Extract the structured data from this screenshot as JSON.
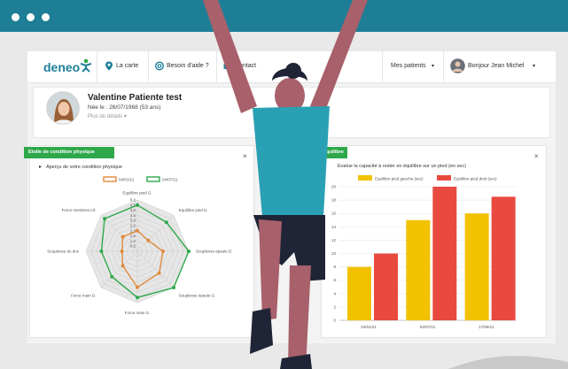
{
  "app": {
    "logo": "deneo",
    "nav": {
      "map": "La carte",
      "help": "Besoin d'aide ?",
      "contact": "Contact",
      "patients": "Mes patients",
      "user": "Bonjour Jean Michel"
    }
  },
  "patient": {
    "name": "Valentine Patiente test",
    "dob": "Née le : 26/07/1968 (53 ans)",
    "more": "Plus de détails"
  },
  "radar_panel": {
    "tag": "Etoile de condition physique",
    "subtitle": "Aperçu de votre condition physique",
    "close": "×"
  },
  "bar_panel": {
    "tag": "équilibre",
    "subtitle": "Evalue la capacité à rester en équilibre sur un pied (en sec)",
    "close": "×"
  },
  "colors": {
    "brand": "#1f7f99",
    "green": "#2ea84a",
    "orange": "#e08a3c",
    "yellow": "#f2c200",
    "red": "#e84a3f",
    "figure_skin": "#a8606a",
    "figure_shirt": "#2aa0b4",
    "figure_pants": "#1f2536"
  },
  "chart_data": [
    {
      "type": "radar",
      "series": [
        {
          "name": "04/01/21",
          "color": "#e08a3c",
          "values": [
            2,
            1.5,
            2.5,
            3,
            3.5,
            2,
            1.5,
            2
          ]
        },
        {
          "name": "04/07/21",
          "color": "#2ea84a",
          "values": [
            4.5,
            4,
            5,
            5,
            4.5,
            3.5,
            3.5,
            4.5
          ]
        }
      ],
      "axes": [
        "Equilibre pied G.",
        "Equilibre pied D.",
        "Souplesse épaule D.",
        "Souplesse épaule G.",
        "Force main G.",
        "Force main D.",
        "Souplesse du dos",
        "Force membres inf."
      ],
      "ticks": [
        "5.0",
        "4.5",
        "4.0",
        "3.5",
        "3.0",
        "2.5",
        "2.0",
        "1.5",
        "1.0",
        "0.5"
      ],
      "rmax": 5
    },
    {
      "type": "bar",
      "categories": [
        "04/01/21",
        "04/07/21",
        "17/09/21"
      ],
      "series": [
        {
          "name": "Equilibre pied gauche (sec)",
          "color": "#f2c200",
          "values": [
            8,
            15,
            16
          ]
        },
        {
          "name": "Equilibre pied droit (sec)",
          "color": "#e84a3f",
          "values": [
            10,
            20,
            18.5
          ]
        }
      ],
      "ylim": [
        0,
        20
      ],
      "yticks": [
        "0",
        "2",
        "4",
        "6",
        "8",
        "10",
        "12",
        "14",
        "16",
        "18",
        "20"
      ]
    }
  ]
}
